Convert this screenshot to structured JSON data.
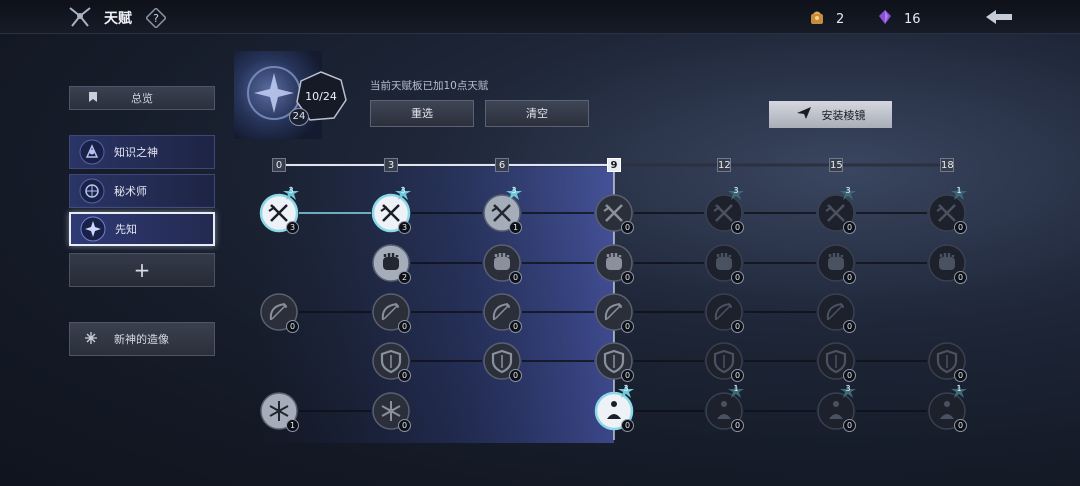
{
  "header": {
    "title": "天赋",
    "help_icon": "question-icon",
    "resources": [
      {
        "icon": "gift-bag-icon",
        "value": "2"
      },
      {
        "icon": "purple-crystal-icon",
        "value": "16"
      }
    ],
    "back_icon": "back-arrow-icon"
  },
  "sidebar": {
    "overview_label": "总览",
    "gods": [
      {
        "label": "知识之神",
        "icon": "knowledge-god-icon"
      },
      {
        "label": "秘术师",
        "icon": "arcanist-icon"
      },
      {
        "label": "先知",
        "icon": "prophet-icon",
        "selected": true
      }
    ],
    "add_label": "+",
    "statue_label": "新神的造像"
  },
  "talent_board": {
    "points": "10/24",
    "level": "24",
    "info_text": "当前天赋板已加10点天赋",
    "reset_label": "重选",
    "clear_label": "清空",
    "install_label": "安装棱镜",
    "thresholds": [
      "0",
      "3",
      "6",
      "9",
      "12",
      "15",
      "18"
    ],
    "current_threshold_index": 3
  },
  "tree": {
    "rows": [
      {
        "icon": "crossed-swords-icon",
        "nodes": [
          {
            "col": 0,
            "value": "3",
            "stars": "3",
            "active": true
          },
          {
            "col": 1,
            "value": "3",
            "stars": "3",
            "active": true
          },
          {
            "col": 2,
            "value": "1",
            "stars": "3",
            "active": false
          },
          {
            "col": 3,
            "value": "0",
            "stars": "",
            "active": false
          },
          {
            "col": 4,
            "value": "0",
            "stars": "3",
            "active": false
          },
          {
            "col": 5,
            "value": "0",
            "stars": "3",
            "active": false
          },
          {
            "col": 6,
            "value": "0",
            "stars": "1",
            "active": false
          }
        ]
      },
      {
        "icon": "fist-icon",
        "nodes": [
          {
            "col": 1,
            "value": "2",
            "stars": "",
            "active": false
          },
          {
            "col": 2,
            "value": "0",
            "stars": "",
            "active": false
          },
          {
            "col": 3,
            "value": "0",
            "stars": "",
            "active": false
          },
          {
            "col": 4,
            "value": "0",
            "stars": "",
            "active": false
          },
          {
            "col": 5,
            "value": "0",
            "stars": "",
            "active": false
          },
          {
            "col": 6,
            "value": "0",
            "stars": "",
            "active": false
          }
        ]
      },
      {
        "icon": "bow-icon",
        "nodes": [
          {
            "col": 0,
            "value": "0",
            "stars": "",
            "active": false
          },
          {
            "col": 1,
            "value": "0",
            "stars": "",
            "active": false
          },
          {
            "col": 2,
            "value": "0",
            "stars": "",
            "active": false
          },
          {
            "col": 3,
            "value": "0",
            "stars": "",
            "active": false
          },
          {
            "col": 4,
            "value": "0",
            "stars": "",
            "active": false
          },
          {
            "col": 5,
            "value": "0",
            "stars": "",
            "active": false
          }
        ]
      },
      {
        "icon": "shield-icon",
        "nodes": [
          {
            "col": 1,
            "value": "0",
            "stars": "",
            "active": false
          },
          {
            "col": 2,
            "value": "0",
            "stars": "",
            "active": false
          },
          {
            "col": 3,
            "value": "0",
            "stars": "",
            "active": false
          },
          {
            "col": 4,
            "value": "0",
            "stars": "",
            "active": false
          },
          {
            "col": 5,
            "value": "0",
            "stars": "",
            "active": false
          },
          {
            "col": 6,
            "value": "0",
            "stars": "",
            "active": false
          }
        ]
      },
      {
        "icon": "snowflake-icon",
        "nodes": [
          {
            "col": 0,
            "value": "1",
            "stars": "",
            "active": false
          },
          {
            "col": 1,
            "value": "0",
            "stars": "",
            "active": false
          },
          {
            "col": 3,
            "value": "0",
            "stars": "3",
            "active": true
          },
          {
            "col": 4,
            "value": "0",
            "stars": "1",
            "active": false
          },
          {
            "col": 5,
            "value": "0",
            "stars": "3",
            "active": false
          },
          {
            "col": 6,
            "value": "0",
            "stars": "1",
            "active": false
          }
        ]
      }
    ]
  },
  "colors": {
    "accent": "#5b6fd8",
    "active_ring": "#8ad8e8",
    "highlight": "#e9ecf3"
  }
}
